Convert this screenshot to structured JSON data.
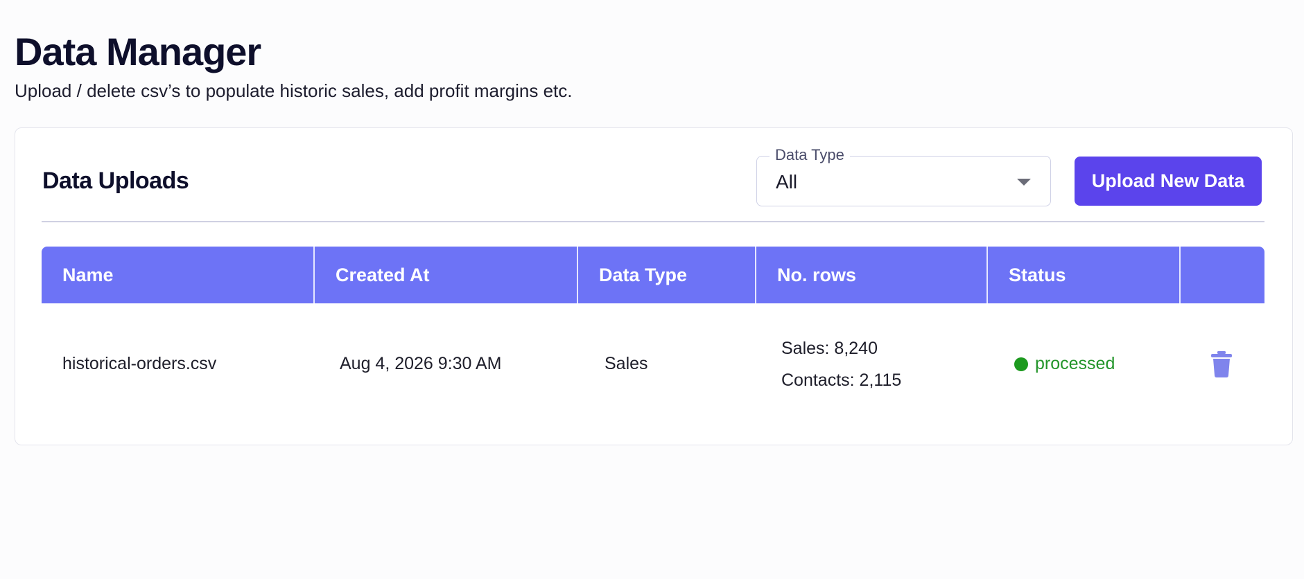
{
  "header": {
    "title": "Data Manager",
    "subtitle": "Upload / delete csv’s to populate historic sales, add profit margins etc."
  },
  "uploads": {
    "title": "Data Uploads",
    "filter": {
      "label": "Data Type",
      "value": "All"
    },
    "upload_button": "Upload New Data",
    "columns": [
      "Name",
      "Created At",
      "Data Type",
      "No. rows",
      "Status",
      ""
    ],
    "rows": [
      {
        "name": "historical-orders.csv",
        "created_at": "Aug 4, 2026 9:30 AM",
        "data_type": "Sales",
        "rows_sales": "Sales: 8,240",
        "rows_contacts": "Contacts: 2,115",
        "status": "processed"
      }
    ]
  },
  "colors": {
    "accent": "#5b44ec",
    "table_header": "#6d73f6",
    "status_processed": "#1d9a1f",
    "trash_icon": "#7f84ec"
  },
  "icons": {
    "select_caret": "caret-down-icon",
    "delete": "trash-icon",
    "status": "status-dot-icon"
  }
}
